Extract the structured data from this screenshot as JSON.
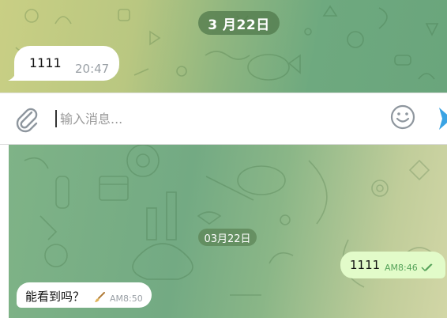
{
  "top_chat": {
    "date_label": "3 月22日",
    "message": {
      "text": "1111",
      "time": "20:47"
    }
  },
  "composer": {
    "placeholder": "输入消息...",
    "value": "",
    "attach_icon": "paperclip-icon",
    "emoji_icon": "smile-icon",
    "send_icon": "send-icon",
    "accent": "#3aa3e3"
  },
  "bottom_chat": {
    "date_label": "03月22日",
    "outgoing": {
      "text": "1111",
      "time": "AM8:46",
      "status_icon": "double-check-icon"
    },
    "incoming": {
      "text": "能看到吗？",
      "time": "AM8:50",
      "edited_icon": "brush-icon"
    }
  },
  "colors": {
    "outgoing_bubble": "#e2fbc9",
    "incoming_bubble": "#ffffff",
    "outgoing_time": "#56a35a"
  }
}
